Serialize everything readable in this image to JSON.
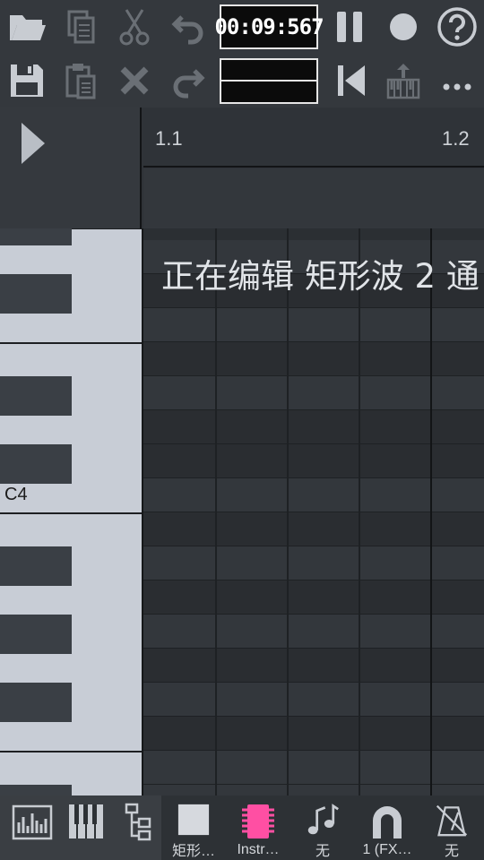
{
  "toolbar": {
    "time_display": "00:09:567",
    "buttons_row1": [
      "open-folder-icon",
      "copy-icon",
      "cut-icon",
      "undo-icon",
      "pause-icon",
      "record-icon",
      "help-icon"
    ],
    "buttons_row2": [
      "save-icon",
      "paste-icon",
      "delete-icon",
      "redo-icon",
      "skip-to-start-icon",
      "piano-export-icon",
      "more-icon"
    ]
  },
  "timeline": {
    "markers": [
      "1.1",
      "1.2"
    ]
  },
  "piano_roll": {
    "note_label": "C4",
    "editing_banner": "正在编辑 矩形波 2 通"
  },
  "bottom_bar": {
    "items": [
      {
        "icon": "mixer-icon",
        "label": ""
      },
      {
        "icon": "piano-keys-icon",
        "label": ""
      },
      {
        "icon": "hierarchy-icon",
        "label": ""
      },
      {
        "icon": "square-wave-icon",
        "label": "矩形…"
      },
      {
        "icon": "chip-icon",
        "label": "Instr…"
      },
      {
        "icon": "notes-icon",
        "label": "无"
      },
      {
        "icon": "magnet-icon",
        "label": "1 (FX…"
      },
      {
        "icon": "metronome-off-icon",
        "label": "无"
      }
    ]
  },
  "colors": {
    "accent_pink": "#ff4fa3",
    "background": "#2f3338"
  }
}
